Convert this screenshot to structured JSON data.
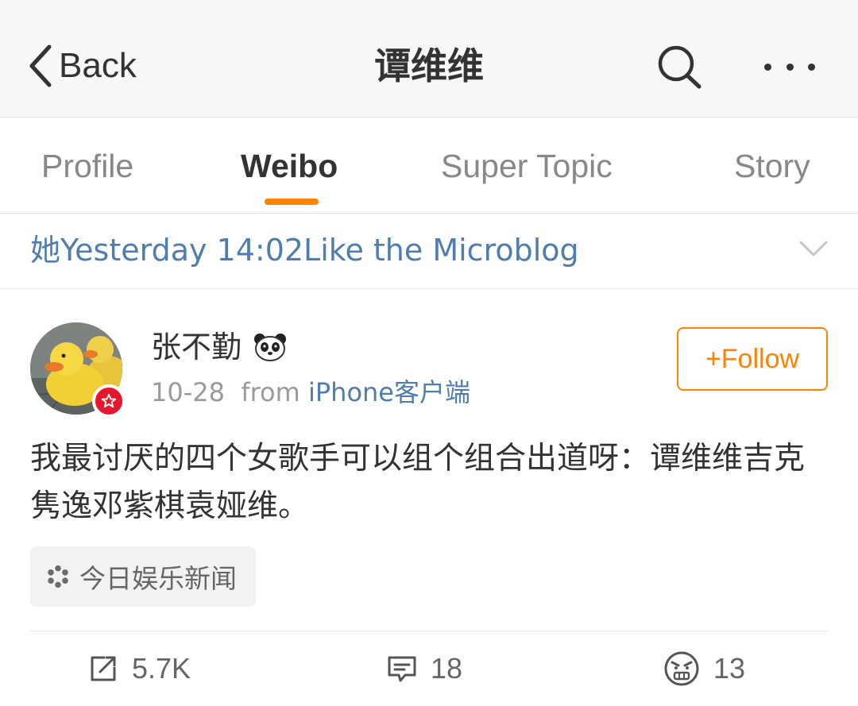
{
  "nav": {
    "back_label": "Back",
    "title": "谭维维"
  },
  "tabs": [
    {
      "label": "Profile",
      "active": false
    },
    {
      "label": "Weibo",
      "active": true
    },
    {
      "label": "Super Topic",
      "active": false
    },
    {
      "label": "Story",
      "active": false
    }
  ],
  "notice": {
    "text": "她Yesterday 14:02Like the Microblog"
  },
  "post": {
    "username": "张不勤",
    "date": "10-28",
    "from_label": "from",
    "source": "iPhone客户端",
    "follow_label": "+Follow",
    "text": "我最讨厌的四个女歌手可以组个组合出道呀：谭维维吉克隽逸邓紫棋袁娅维。",
    "topic": "今日娱乐新闻",
    "actions": {
      "repost_count": "5.7K",
      "comment_count": "18",
      "reaction_count": "13"
    }
  },
  "colors": {
    "accent": "#ff8200",
    "link": "#507daf",
    "verified_badge": "#e6162d"
  }
}
